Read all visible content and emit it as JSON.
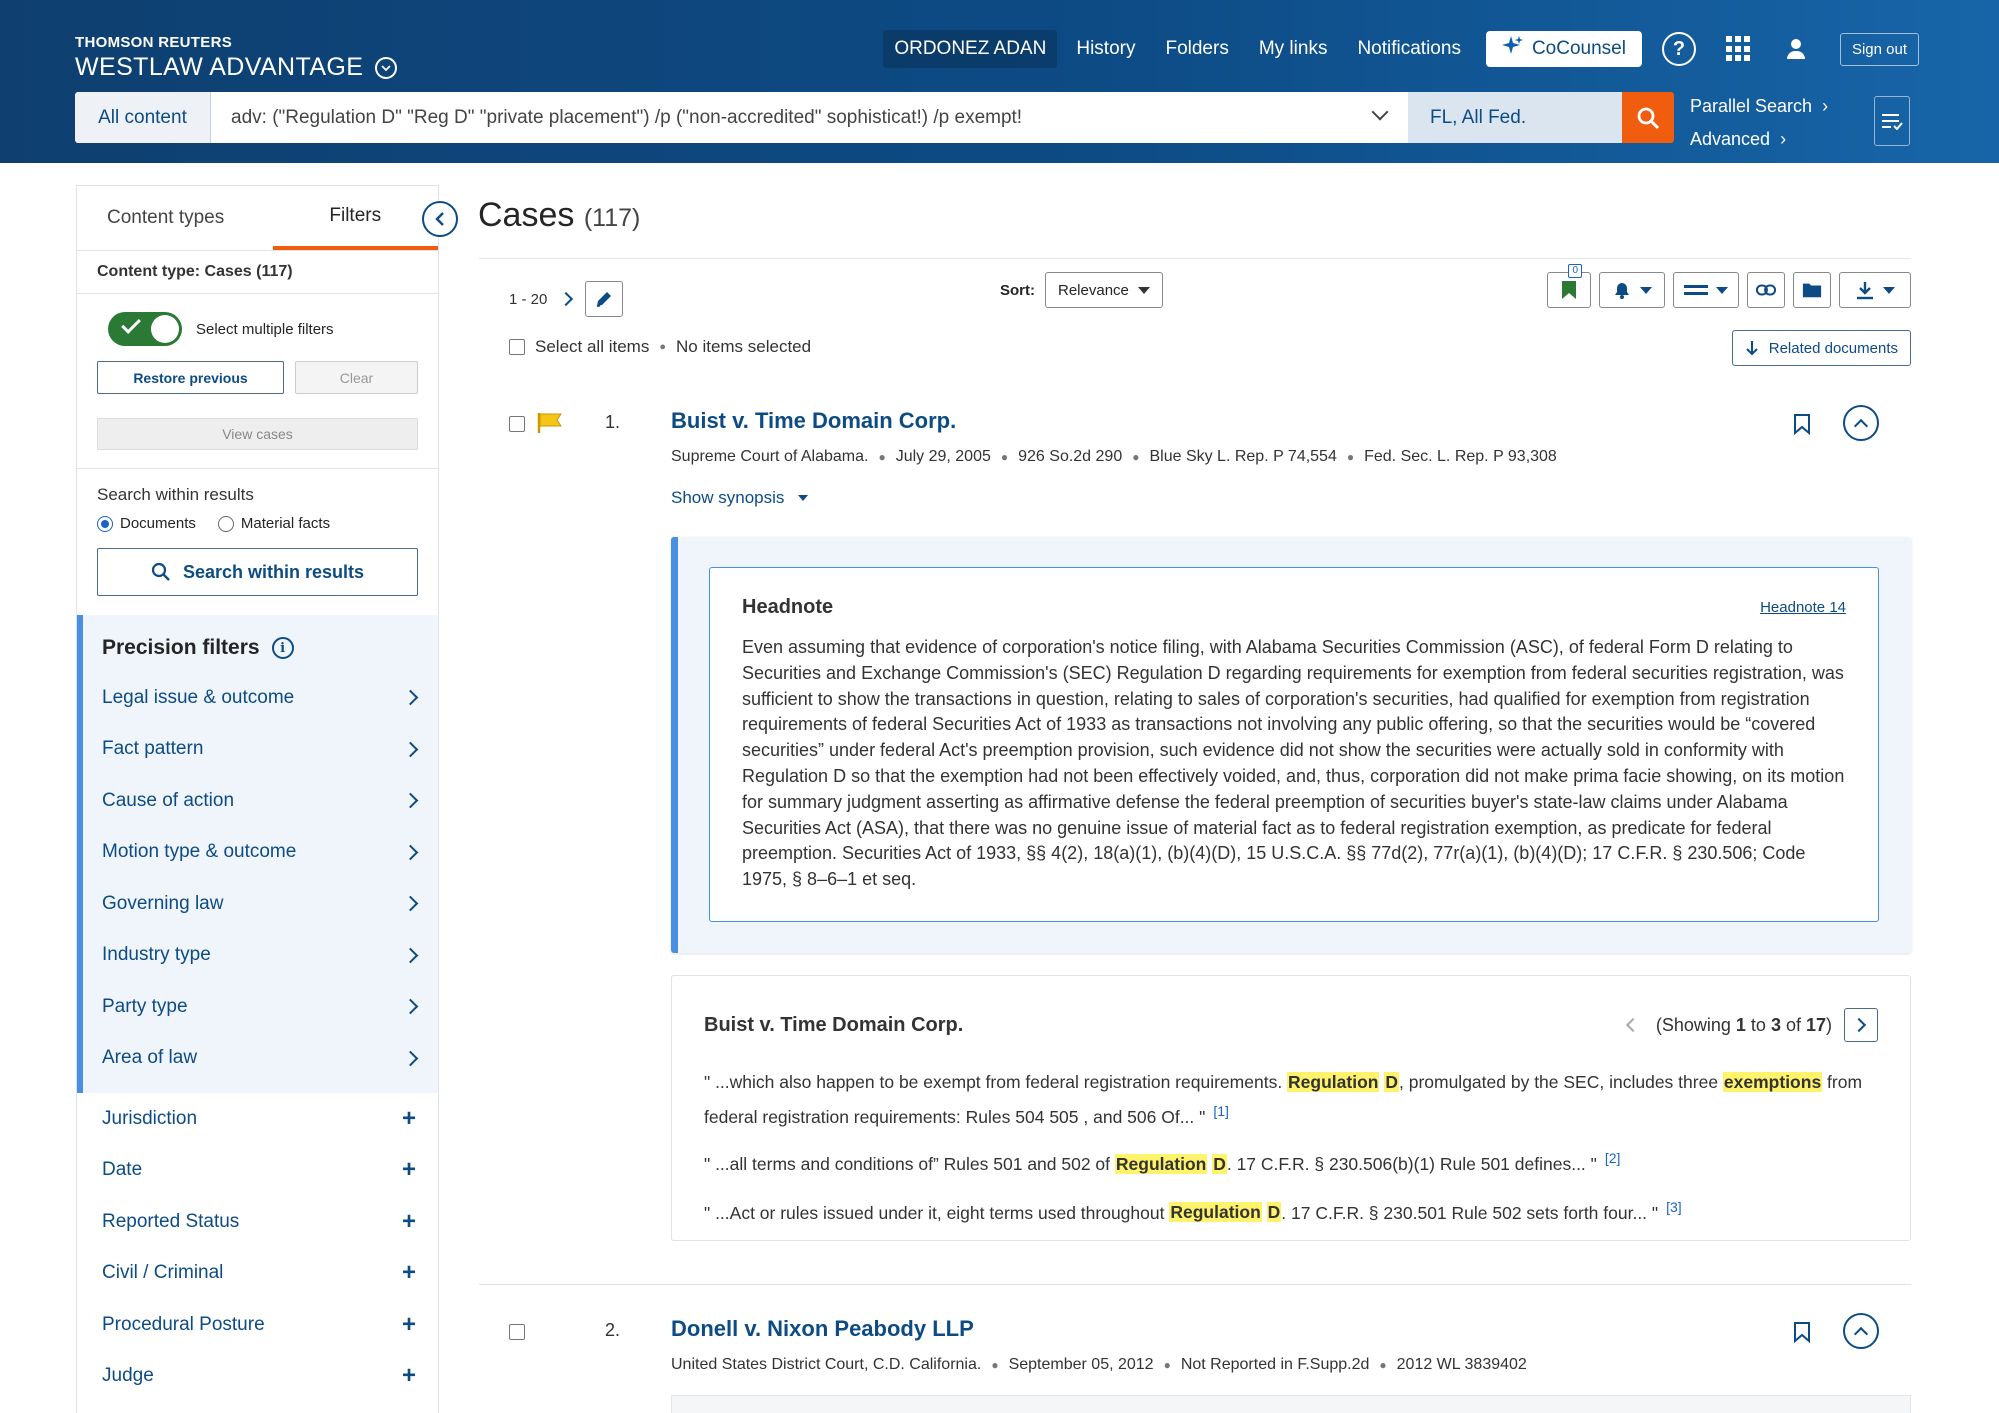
{
  "header": {
    "brand_top": "THOMSON REUTERS",
    "brand_main": "WESTLAW ADVANTAGE",
    "user": "ORDONEZ ADAN",
    "nav": [
      "History",
      "Folders",
      "My links",
      "Notifications"
    ],
    "cocounsel": "CoCounsel",
    "help": "?",
    "signout": "Sign out"
  },
  "search": {
    "scope": "All content",
    "query": "adv: (\"Regulation D\" \"Reg D\" \"private placement\") /p (\"non-accredited\" sophisticat!) /p exempt!",
    "jurisdiction": "FL, All Fed.",
    "parallel": "Parallel Search",
    "advanced": "Advanced"
  },
  "sidebar": {
    "tab_content_types": "Content types",
    "tab_filters": "Filters",
    "content_type": "Content type: Cases (117)",
    "select_multiple": "Select multiple filters",
    "restore": "Restore previous",
    "clear": "Clear",
    "view_cases": "View cases",
    "search_within_title": "Search within results",
    "radio_documents": "Documents",
    "radio_material": "Material facts",
    "search_within_button": "Search within results",
    "precision_title": "Precision filters",
    "precision_filters": [
      "Legal issue & outcome",
      "Fact pattern",
      "Cause of action",
      "Motion type & outcome",
      "Governing law",
      "Industry type",
      "Party type",
      "Area of law"
    ],
    "other_filters": [
      "Jurisdiction",
      "Date",
      "Reported Status",
      "Civil / Criminal",
      "Procedural Posture",
      "Judge"
    ]
  },
  "main": {
    "title": "Cases",
    "count": "(117)",
    "pager": "1 - 20",
    "sort_label": "Sort:",
    "sort_value": "Relevance",
    "flag_count": "0",
    "select_all": "Select all items",
    "no_items": "No items selected",
    "related": "Related documents"
  },
  "results": [
    {
      "num": "1.",
      "title": "Buist v. Time Domain Corp.",
      "meta": [
        "Supreme Court of Alabama.",
        "July 29, 2005",
        "926 So.2d 290",
        "Blue Sky L. Rep. P 74,554",
        "Fed. Sec. L. Rep. P 93,308"
      ],
      "synopsis": "Show synopsis",
      "headnote_title": "Headnote",
      "headnote_link": "Headnote 14",
      "headnote_text": "Even assuming that evidence of corporation's notice filing, with Alabama Securities Commission (ASC), of federal Form D relating to Securities and Exchange Commission's (SEC) Regulation D regarding requirements for exemption from federal securities registration, was sufficient to show the transactions in question, relating to sales of corporation's securities, had qualified for exemption from registration requirements of federal Securities Act of 1933 as transactions not involving any public offering, so that the securities would be “covered securities” under federal Act's preemption provision, such evidence did not show the securities were actually sold in conformity with Regulation D so that the exemption had not been effectively voided, and, thus, corporation did not make prima facie showing, on its motion for summary judgment asserting as affirmative defense the federal preemption of securities buyer's state-law claims under Alabama Securities Act (ASA), that there was no genuine issue of material fact as to federal registration exemption, as predicate for federal preemption.   Securities Act of 1933, §§  4(2), 18(a)(1), (b)(4)(D), 15 U.S.C.A. §§  77d(2), 77r(a)(1), (b)(4)(D); 17 C.F.R. §  230.506; Code 1975, §  8–6–1 et seq.",
      "snippet_title": "Buist v. Time Domain Corp.",
      "snippet_showing_pre": "(Showing ",
      "snippet_from": "1",
      "snippet_to_word": " to ",
      "snippet_to": "3",
      "snippet_of_word": " of ",
      "snippet_total": "17",
      "snippet_close": ")",
      "snippets": [
        {
          "a": "\" ...which also happen to be exempt from federal registration requirements. ",
          "h1": "Regulation",
          "b": " ",
          "h2": "D",
          "c": ", promulgated by the SEC, includes three ",
          "h3": "exemptions",
          "d": " from federal registration requirements:  Rules 504 505 , and 506   Of... \"",
          "fn": "[1]"
        },
        {
          "a": "\" ...all terms and conditions of” Rules 501 and 502 of ",
          "h1": "Regulation",
          "b": " ",
          "h2": "D",
          "c": ". 17 C.F.R. §  230.506(b)(1) Rule 501 defines... \"",
          "fn": "[2]"
        },
        {
          "a": "\" ...Act or rules issued under it, eight terms used throughout ",
          "h1": "Regulation",
          "b": " ",
          "h2": "D",
          "c": ". 17 C.F.R. §  230.501 Rule 502 sets forth four... \"",
          "fn": "[3]"
        }
      ]
    },
    {
      "num": "2.",
      "title": "Donell v. Nixon Peabody LLP",
      "meta": [
        "United States District Court, C.D. California.",
        "September 05, 2012",
        "Not Reported in F.Supp.2d",
        "2012 WL 3839402"
      ]
    }
  ],
  "colors": {
    "header": "#0d4b85",
    "accent": "#f05d0e",
    "link": "#0d4b85",
    "highlight": "#fff36b",
    "toggle_on": "#2a7a36"
  },
  "icons": [
    "chevron-circle-icon",
    "sparkle-icon",
    "help-circle-icon",
    "apps-grid-icon",
    "person-icon",
    "search-icon",
    "chevron-down-icon",
    "list-settings-icon",
    "chevron-left-icon",
    "chevron-right-icon",
    "pencil-icon",
    "bookmark-icon",
    "bell-icon",
    "view-icon",
    "link-icon",
    "folder-icon",
    "download-icon",
    "arrow-down-icon",
    "flag-icon",
    "chevron-up-icon",
    "info-icon",
    "plus-icon"
  ]
}
